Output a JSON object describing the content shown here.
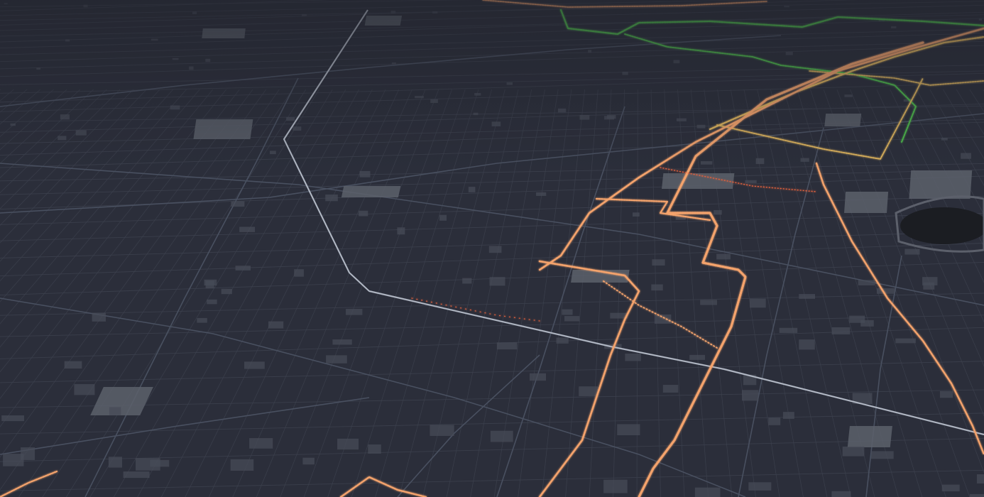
{
  "map": {
    "view": "3d-perspective",
    "theme": "dark",
    "labels_shown": false,
    "colors": {
      "background": "#2b2e3a",
      "sky_haze": "#262934",
      "street_minor": "#3c404d",
      "street_major": "#495060",
      "building": "#474b57",
      "large_building": "#5c606b",
      "water": "#1b1d22",
      "transit_line": "#9fa6b3",
      "trace_high": "#f4a36c",
      "trace_mid": "#e0b55d",
      "trace_low": "#4fbf4c",
      "trace_hot": "#e0603c"
    },
    "layers": [
      {
        "name": "street-grid",
        "color_key": "street_minor"
      },
      {
        "name": "arterial-roads",
        "color_key": "street_major"
      },
      {
        "name": "buildings",
        "color_key": "building"
      },
      {
        "name": "rail-line",
        "color_key": "transit_line"
      },
      {
        "name": "activity-traces",
        "color_key": "trace_high"
      }
    ]
  }
}
